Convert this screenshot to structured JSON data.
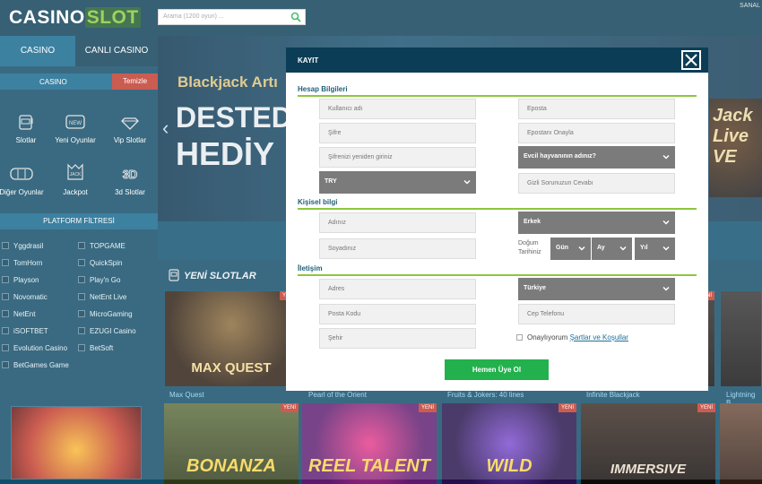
{
  "header": {
    "logo_part1": "CASINO",
    "logo_part2": "SLOT",
    "search_placeholder": "Arama (1200 oyun) ...",
    "top_link": "SANAL"
  },
  "sidebar": {
    "tab_casino": "CASINO",
    "tab_live": "CANLI CASINO",
    "section_title": "CASINO",
    "clear_label": "Temizle",
    "categories": [
      {
        "label": "Slotlar",
        "icon": "slot-machine-icon"
      },
      {
        "label": "Yeni Oyunlar",
        "icon": "new-icon"
      },
      {
        "label": "Vip Slotlar",
        "icon": "diamond-icon"
      },
      {
        "label": "Diğer Oyunlar",
        "icon": "reels-icon"
      },
      {
        "label": "Jackpot",
        "icon": "jackpot-icon"
      },
      {
        "label": "3d Slotlar",
        "icon": "3d-icon"
      }
    ],
    "filter_title": "PLATFORM FİLTRESİ",
    "providers": [
      "Yggdrasil",
      "TOPGAME",
      "TomHorn",
      "QuickSpin",
      "Playson",
      "Play'n Go",
      "Novomatic",
      "NetEnt Live",
      "NetEnt",
      "MicroGaming",
      "iSOFTBET",
      "EZUGI Casino",
      "Evolution Casino",
      "BetSoft",
      "BetGames Game"
    ]
  },
  "banner": {
    "line1": "Blackjack Artı",
    "line2": "DESTEDE",
    "line3": "HEDİY",
    "right_text": "Jack Live VE"
  },
  "new_slots": {
    "title": "YENİ SLOTLAR",
    "badge": "YENİ",
    "games_row1": [
      {
        "name": "Max Quest",
        "art": "MAX QUEST"
      },
      {
        "name": "Pearl of the Orient",
        "art": ""
      },
      {
        "name": "Fruits & Jokers: 40 lines",
        "art": ""
      },
      {
        "name": "Infinite Blackjack",
        "art": ""
      },
      {
        "name": "Lightning B",
        "art": ""
      }
    ],
    "games_row2": [
      {
        "art": "BONANZA"
      },
      {
        "art": "REEL TALENT"
      },
      {
        "art": "WILD"
      },
      {
        "art": "IMMERSIVE"
      }
    ]
  },
  "modal": {
    "title": "KAYIT",
    "sections": {
      "account": "Hesap Bilgileri",
      "personal": "Kişisel bilgi",
      "contact": "İletişim"
    },
    "fields": {
      "username": "Kullanıcı adı",
      "email": "Eposta",
      "password": "Şifre",
      "email_confirm": "Epostanı Onayla",
      "password_repeat": "Şifrenizi yeniden giriniz",
      "security_question": "Evcil hayvanının adınız?",
      "currency": "TRY",
      "security_answer": "Gizli Sorunuzun Cevabı",
      "first_name": "Adınız",
      "gender": "Erkek",
      "last_name": "Soyadınız",
      "birth_label": "Doğum Tarihiniz",
      "day": "Gün",
      "month": "Ay",
      "year": "Yıl",
      "address": "Adres",
      "country": "Türkiye",
      "postal_code": "Posta Kodu",
      "phone": "Cep Telefonu",
      "city": "Şehir"
    },
    "terms_prefix": "Onaylıyorum",
    "terms_link": "Şartlar ve Koşullar",
    "submit": "Hemen Üye Ol"
  }
}
